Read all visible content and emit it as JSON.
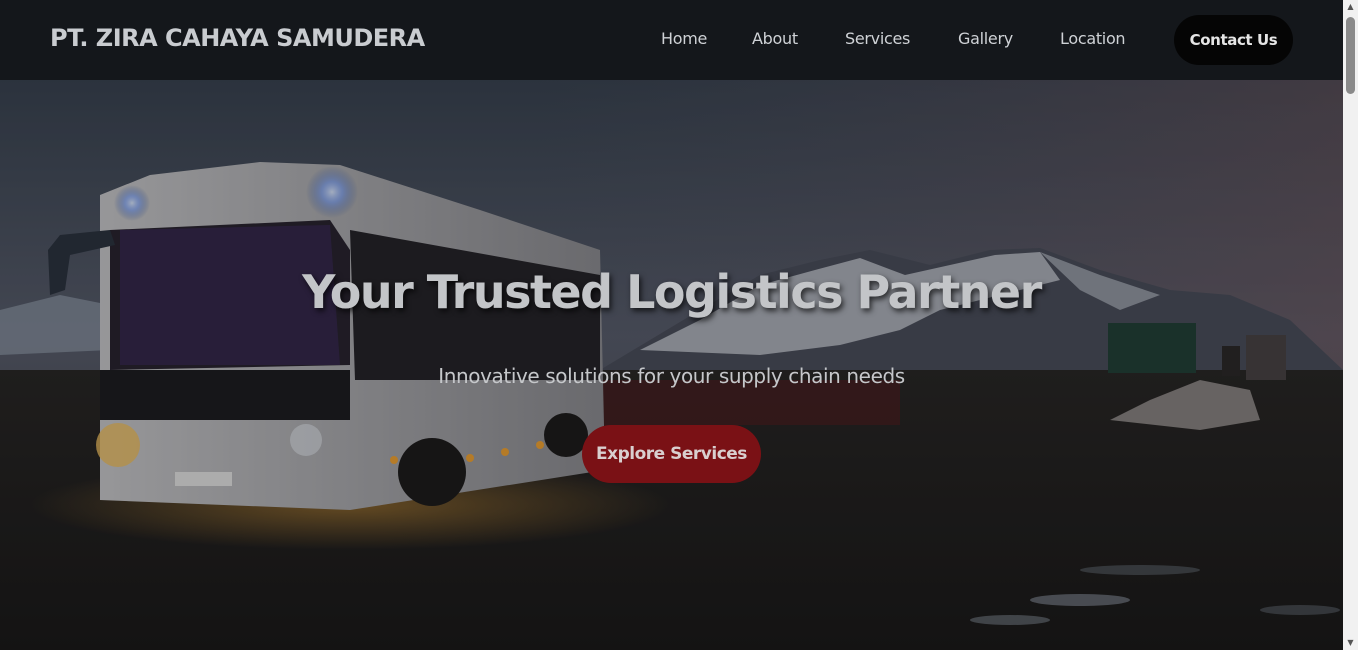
{
  "header": {
    "brand": "PT. ZIRA CAHAYA SAMUDERA",
    "nav": [
      "Home",
      "About",
      "Services",
      "Gallery",
      "Location"
    ],
    "contact_label": "Contact Us"
  },
  "hero": {
    "title": "Your Trusted Logistics Partner",
    "subtitle": "Innovative solutions for your supply chain needs",
    "cta_label": "Explore Services"
  },
  "colors": {
    "navbar": "#14171b",
    "cta": "#7a1115",
    "contact_button": "#050505"
  },
  "icons": {
    "scroll_up": "chevron-up-icon",
    "scroll_down": "chevron-down-icon"
  }
}
